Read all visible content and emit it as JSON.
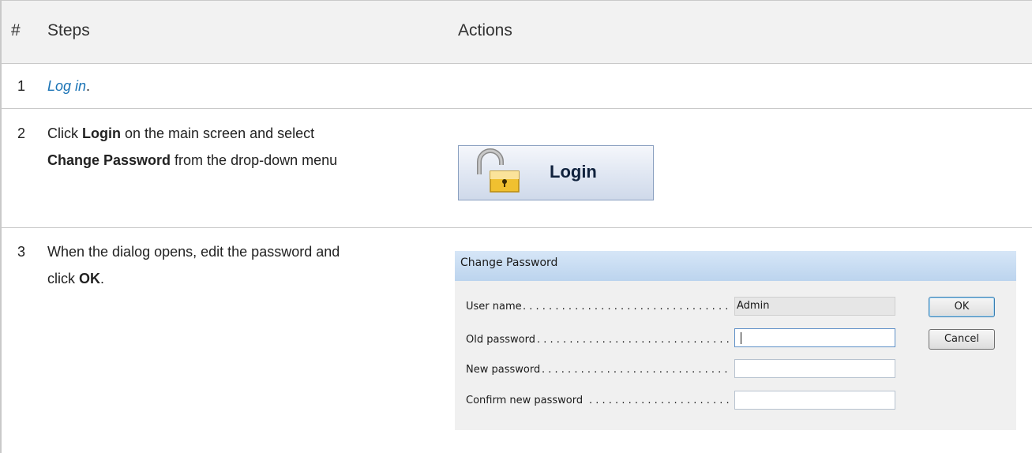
{
  "table": {
    "headers": {
      "num": "#",
      "steps": "Steps",
      "actions": "Actions"
    },
    "rows": [
      {
        "num": "1",
        "link": "Log in",
        "after": "."
      },
      {
        "num": "2",
        "text_a": "Click ",
        "bold_a": "Login",
        "text_b": " on the main screen and select",
        "bold_b": "Change Password",
        "text_c": " from the drop-down menu"
      },
      {
        "num": "3",
        "text_a": "When the dialog opens, edit the password and",
        "text_b": "click ",
        "bold_a": "OK",
        "text_c": "."
      }
    ]
  },
  "login_button": {
    "label": "Login",
    "icon": "lock-icon"
  },
  "dialog": {
    "title": "Change Password",
    "fields": [
      {
        "label": "User name",
        "value": "Admin",
        "readonly": true
      },
      {
        "label": "Old password",
        "value": "",
        "focused": true
      },
      {
        "label": "New password",
        "value": ""
      },
      {
        "label": "Confirm new password",
        "value": ""
      }
    ],
    "ok_label": "OK",
    "cancel_label": "Cancel"
  },
  "colors": {
    "link": "#1a73b5",
    "header_bg": "#f2f2f2",
    "grid": "#c9c9c9",
    "dialog_title": "#bcd4ee"
  }
}
